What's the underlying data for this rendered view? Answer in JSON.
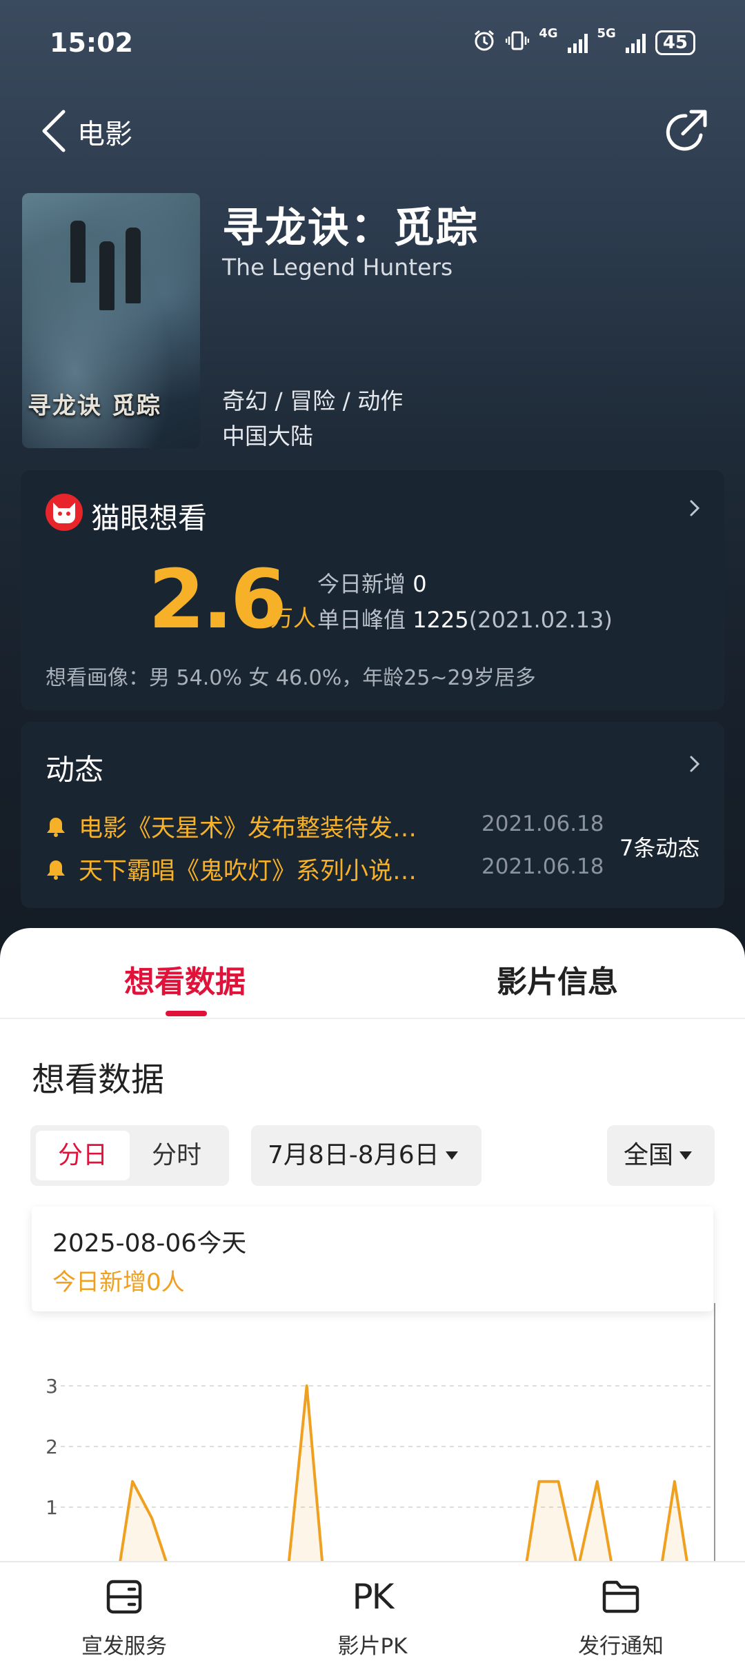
{
  "status_bar": {
    "time": "15:02",
    "network_1": "4G",
    "network_2": "5G",
    "battery": "45"
  },
  "nav": {
    "back_icon": "chevron-left-icon",
    "title": "电影",
    "share_icon": "share-icon"
  },
  "movie": {
    "poster_title": "寻龙诀 觅踪",
    "title": "寻龙诀：觅踪",
    "english_title": "The Legend Hunters",
    "genres": "奇幻 / 冒险 / 动作",
    "region": "中国大陆"
  },
  "want_card": {
    "brand": "猫眼想看",
    "count": "2.6",
    "unit": "万人",
    "today_label": "今日新增",
    "today_value": "0",
    "peak_label": "单日峰值",
    "peak_value": "1225",
    "peak_date": "(2021.02.13)",
    "portrait": "想看画像：男 54.0%  女 46.0%，年龄25~29岁居多",
    "accent_color": "#f6b128"
  },
  "news_card": {
    "title": "动态",
    "items": [
      {
        "text": "电影《天星术》发布整装待发…",
        "date": "2021.06.18"
      },
      {
        "text": "天下霸唱《鬼吹灯》系列小说…",
        "date": "2021.06.18"
      }
    ],
    "count_label": "7条动态"
  },
  "tabs": [
    {
      "label": "想看数据",
      "active": true
    },
    {
      "label": "影片信息",
      "active": false
    }
  ],
  "section": {
    "title": "想看数据",
    "segments": [
      "分日",
      "分时"
    ],
    "date_range": "7月8日-8月6日",
    "region": "全国"
  },
  "tooltip": {
    "date": "2025-08-06",
    "day_label": "今天",
    "value_text": "今日新增0人"
  },
  "chart_data": {
    "type": "area",
    "title": "",
    "xlabel": "",
    "ylabel": "",
    "y_tick_labels": [
      "3",
      "2",
      "1",
      "1"
    ],
    "ylim": [
      0,
      3
    ],
    "grid": true,
    "line_color": "#f0a020",
    "series": [
      {
        "values": [
          0,
          0,
          1.7,
          1.2,
          0.4,
          0.4,
          0,
          0,
          0.4,
          0,
          0.4,
          3,
          0,
          0,
          0,
          0.4,
          0,
          0.4,
          0,
          0.4,
          0,
          0,
          0,
          1.7,
          1.7,
          0.5,
          1.7,
          0.2,
          0,
          0,
          1.7,
          0
        ]
      }
    ]
  },
  "bottom_nav": [
    {
      "label": "宣发服务",
      "icon": "service-icon"
    },
    {
      "label": "影片PK",
      "icon": "pk-icon",
      "icon_text": "PK"
    },
    {
      "label": "发行通知",
      "icon": "folder-icon"
    }
  ]
}
